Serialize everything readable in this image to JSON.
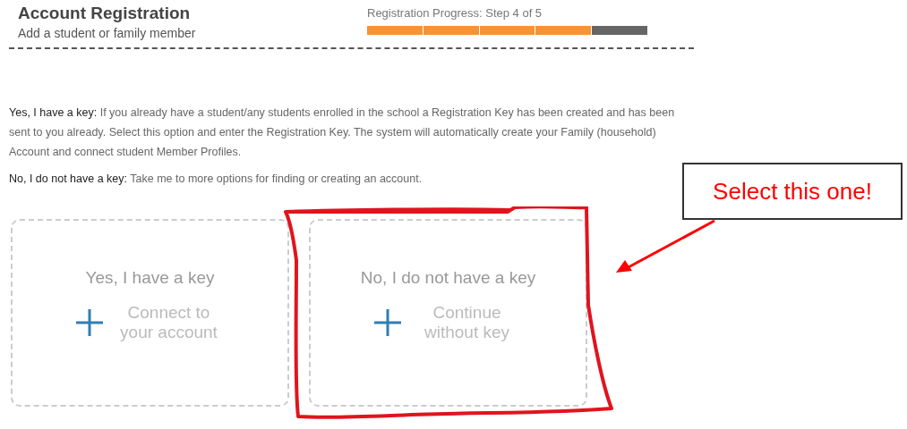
{
  "header": {
    "title": "Account Registration",
    "subtitle": "Add a student or family member"
  },
  "progress": {
    "label": "Registration Progress: Step 4 of 5",
    "steps": [
      {
        "completed": true
      },
      {
        "completed": true
      },
      {
        "completed": true
      },
      {
        "completed": true
      },
      {
        "completed": false
      }
    ]
  },
  "explanations": [
    "**Yes, I have a key:** If you already have a student/any students enrolled in the school a Registration Key has been created and has been sent to you already. Select this option and enter the Registration Key. The system will automatically create your Family (household) Account and connect student Member Profiles.",
    "**No, I do not have a key:** Take me to more options for finding or creating an account."
  ],
  "options": [
    {
      "title": "Yes, I have a key",
      "action": "Connect to your account",
      "circled": false
    },
    {
      "title": "No, I do not have a key",
      "action": "Continue without key",
      "circled": true
    }
  ],
  "annotation": {
    "text": "Select this one!"
  }
}
